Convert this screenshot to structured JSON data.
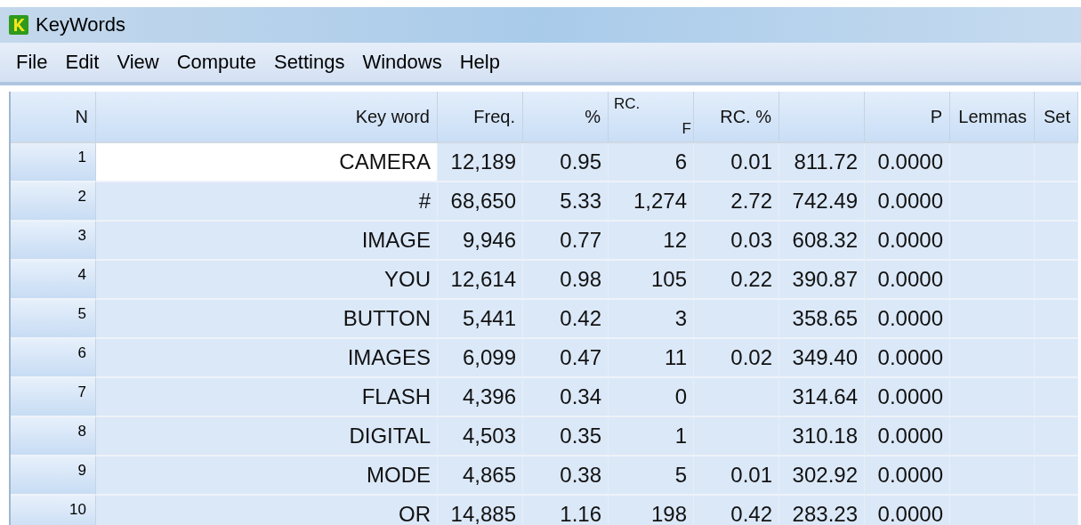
{
  "window": {
    "title": "KeyWords"
  },
  "menu": [
    "File",
    "Edit",
    "View",
    "Compute",
    "Settings",
    "Windows",
    "Help"
  ],
  "table": {
    "columns": [
      {
        "label": "N"
      },
      {
        "label": "Key word"
      },
      {
        "label": "Freq."
      },
      {
        "label": "%"
      },
      {
        "label": "RC.",
        "label_2": "F"
      },
      {
        "label": "RC. %"
      },
      {},
      {
        "label": "P"
      },
      {
        "label": "Lemmas"
      },
      {
        "label": "Set"
      }
    ],
    "rows": [
      {
        "selected": true,
        "cells": [
          "1",
          "CAMERA",
          "12,189",
          "0.95",
          "6",
          "0.01",
          "811.72",
          "0.0000"
        ]
      },
      {
        "selected": false,
        "cells": [
          "2",
          "#",
          "68,650",
          "5.33",
          "1,274",
          "2.72",
          "742.49",
          "0.0000"
        ]
      },
      {
        "selected": false,
        "cells": [
          "3",
          "IMAGE",
          "9,946",
          "0.77",
          "12",
          "0.03",
          "608.32",
          "0.0000"
        ]
      },
      {
        "selected": false,
        "cells": [
          "4",
          "YOU",
          "12,614",
          "0.98",
          "105",
          "0.22",
          "390.87",
          "0.0000"
        ]
      },
      {
        "selected": false,
        "cells": [
          "5",
          "BUTTON",
          "5,441",
          "0.42",
          "3",
          null,
          "358.65",
          "0.0000"
        ]
      },
      {
        "selected": false,
        "cells": [
          "6",
          "IMAGES",
          "6,099",
          "0.47",
          "11",
          "0.02",
          "349.40",
          "0.0000"
        ]
      },
      {
        "selected": false,
        "cells": [
          "7",
          "FLASH",
          "4,396",
          "0.34",
          "0",
          null,
          "314.64",
          "0.0000"
        ]
      },
      {
        "selected": false,
        "cells": [
          "8",
          "DIGITAL",
          "4,503",
          "0.35",
          "1",
          null,
          "310.18",
          "0.0000"
        ]
      },
      {
        "selected": false,
        "cells": [
          "9",
          "MODE",
          "4,865",
          "0.38",
          "5",
          "0.01",
          "302.92",
          "0.0000"
        ]
      },
      {
        "selected": false,
        "cells": [
          "10",
          "OR",
          "14,885",
          "1.16",
          "198",
          "0.42",
          "283.23",
          "0.0000"
        ]
      }
    ]
  }
}
